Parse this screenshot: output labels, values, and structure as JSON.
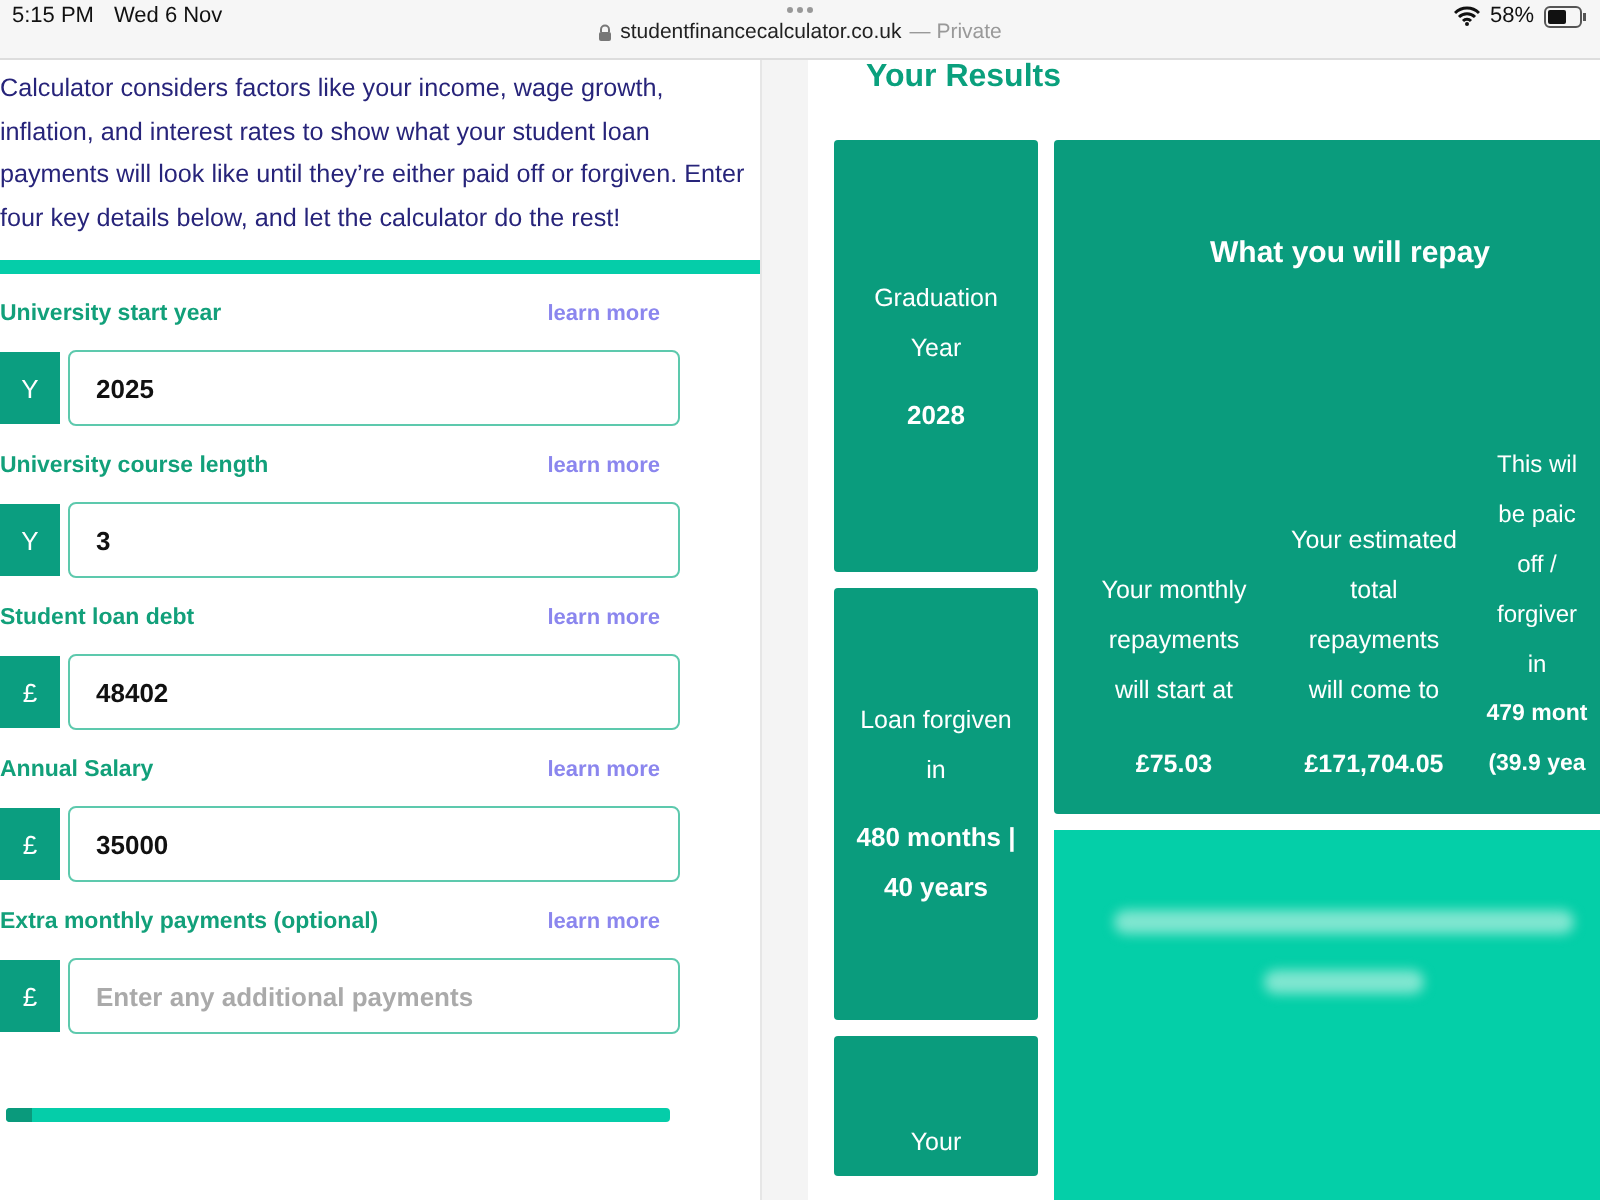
{
  "status_bar": {
    "time": "5:15 PM",
    "date": "Wed 6 Nov",
    "url": "studentfinancecalculator.co.uk",
    "private_label": "— Private",
    "battery": "58%"
  },
  "intro": {
    "text": "Calculator considers factors like your income, wage growth, inflation, and interest rates to show what your student loan payments will look like until they’re either paid off or forgiven. Enter four key details below, and let the calculator do the rest!"
  },
  "fields": [
    {
      "label": "University start year",
      "link": "learn more",
      "prefix": "Y",
      "value": "2025"
    },
    {
      "label": "University course length",
      "link": "learn more",
      "prefix": "Y",
      "value": "3"
    },
    {
      "label": "Student loan debt",
      "link": "learn more",
      "prefix": "£",
      "value": "48402"
    },
    {
      "label": "Annual Salary",
      "link": "learn more",
      "prefix": "£",
      "value": "35000"
    },
    {
      "label": "Extra monthly payments (optional)",
      "link": "learn more",
      "prefix": "£",
      "placeholder": "Enter any additional payments"
    }
  ],
  "progress": {
    "level": 0.04
  },
  "results": {
    "title": "Your Results",
    "side_cards": [
      {
        "label": "Graduation Year",
        "value": "2028"
      },
      {
        "label": "Loan forgiven in",
        "value": "480 months | 40 years"
      },
      {
        "label": "Your"
      }
    ],
    "repay_card": {
      "title": "What you will repay",
      "columns": [
        {
          "label": "Your monthly repayments will start at",
          "value": "£75.03"
        },
        {
          "label": "Your estimated total repayments will come to",
          "value": "£171,704.05"
        },
        {
          "label": "This wil be paic off / forgiver in",
          "value": "479 mont (39.9 yea"
        }
      ]
    }
  }
}
